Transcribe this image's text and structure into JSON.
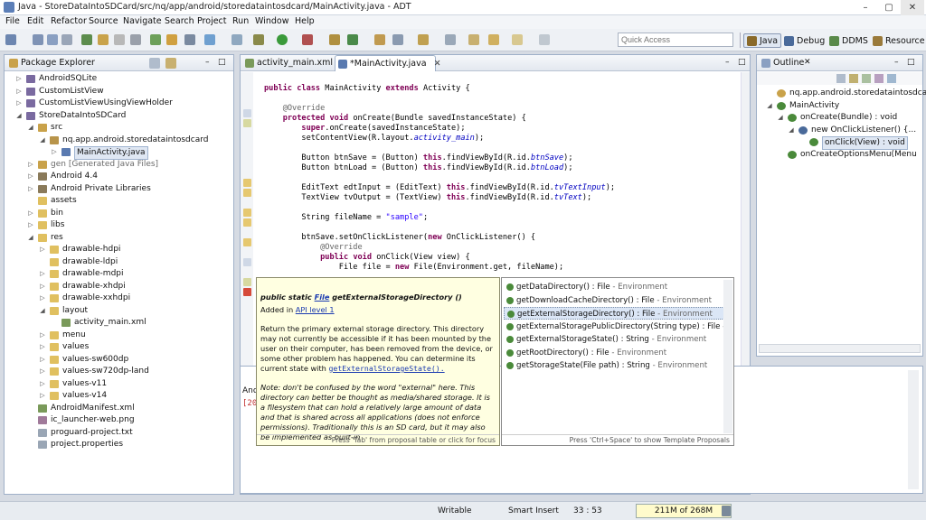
{
  "window": {
    "title": "Java - StoreDataIntoSDCard/src/nq/app/android/storedataintosdcard/MainActivity.java - ADT"
  },
  "menu": [
    "File",
    "Edit",
    "Refactor",
    "Source",
    "Navigate",
    "Search",
    "Project",
    "Run",
    "Window",
    "Help"
  ],
  "quick_access": {
    "placeholder": "Quick Access"
  },
  "perspectives": [
    {
      "label": "Java",
      "icon": "java-perspective-icon",
      "color": "#8a6a2a"
    },
    {
      "label": "Debug",
      "icon": "debug-perspective-icon",
      "color": "#4a6a9a"
    },
    {
      "label": "DDMS",
      "icon": "ddms-perspective-icon",
      "color": "#5a8a4a"
    },
    {
      "label": "Resource",
      "icon": "resource-perspective-icon",
      "color": "#9a7a3a"
    }
  ],
  "package_explorer": {
    "title": "Package Explorer",
    "items": [
      {
        "label": "AndroidSQLite",
        "depth": 0,
        "twisty": "▷",
        "icon": "project-icon"
      },
      {
        "label": "CustomListView",
        "depth": 0,
        "twisty": "▷",
        "icon": "project-icon"
      },
      {
        "label": "CustomListViewUsingViewHolder",
        "depth": 0,
        "twisty": "▷",
        "icon": "project-icon"
      },
      {
        "label": "StoreDataIntoSDCard",
        "depth": 0,
        "twisty": "◢",
        "icon": "project-icon"
      },
      {
        "label": "src",
        "depth": 1,
        "twisty": "◢",
        "icon": "source-folder-icon"
      },
      {
        "label": "nq.app.android.storedataintosdcard",
        "depth": 2,
        "twisty": "◢",
        "icon": "package-icon"
      },
      {
        "label": "MainActivity.java",
        "depth": 3,
        "twisty": "▷",
        "icon": "java-file-icon",
        "selected": true
      },
      {
        "label": "gen [Generated Java Files]",
        "depth": 1,
        "twisty": "▷",
        "icon": "source-folder-icon",
        "muted": true
      },
      {
        "label": "Android 4.4",
        "depth": 1,
        "twisty": "▷",
        "icon": "library-icon"
      },
      {
        "label": "Android Private Libraries",
        "depth": 1,
        "twisty": "▷",
        "icon": "library-icon"
      },
      {
        "label": "assets",
        "depth": 1,
        "twisty": "",
        "icon": "folder-icon"
      },
      {
        "label": "bin",
        "depth": 1,
        "twisty": "▷",
        "icon": "folder-icon"
      },
      {
        "label": "libs",
        "depth": 1,
        "twisty": "▷",
        "icon": "folder-icon"
      },
      {
        "label": "res",
        "depth": 1,
        "twisty": "◢",
        "icon": "folder-icon"
      },
      {
        "label": "drawable-hdpi",
        "depth": 2,
        "twisty": "▷",
        "icon": "folder-icon"
      },
      {
        "label": "drawable-ldpi",
        "depth": 2,
        "twisty": "",
        "icon": "folder-icon"
      },
      {
        "label": "drawable-mdpi",
        "depth": 2,
        "twisty": "▷",
        "icon": "folder-icon"
      },
      {
        "label": "drawable-xhdpi",
        "depth": 2,
        "twisty": "▷",
        "icon": "folder-icon"
      },
      {
        "label": "drawable-xxhdpi",
        "depth": 2,
        "twisty": "▷",
        "icon": "folder-icon"
      },
      {
        "label": "layout",
        "depth": 2,
        "twisty": "◢",
        "icon": "folder-icon"
      },
      {
        "label": "activity_main.xml",
        "depth": 3,
        "twisty": "",
        "icon": "xml-file-icon"
      },
      {
        "label": "menu",
        "depth": 2,
        "twisty": "▷",
        "icon": "folder-icon"
      },
      {
        "label": "values",
        "depth": 2,
        "twisty": "▷",
        "icon": "folder-icon"
      },
      {
        "label": "values-sw600dp",
        "depth": 2,
        "twisty": "▷",
        "icon": "folder-icon"
      },
      {
        "label": "values-sw720dp-land",
        "depth": 2,
        "twisty": "▷",
        "icon": "folder-icon"
      },
      {
        "label": "values-v11",
        "depth": 2,
        "twisty": "▷",
        "icon": "folder-icon"
      },
      {
        "label": "values-v14",
        "depth": 2,
        "twisty": "▷",
        "icon": "folder-icon"
      },
      {
        "label": "AndroidManifest.xml",
        "depth": 1,
        "twisty": "",
        "icon": "xml-file-icon"
      },
      {
        "label": "ic_launcher-web.png",
        "depth": 1,
        "twisty": "",
        "icon": "image-file-icon"
      },
      {
        "label": "proguard-project.txt",
        "depth": 1,
        "twisty": "",
        "icon": "text-file-icon"
      },
      {
        "label": "project.properties",
        "depth": 1,
        "twisty": "",
        "icon": "text-file-icon"
      }
    ]
  },
  "editor": {
    "tabs": [
      {
        "label": "activity_main.xml",
        "active": false
      },
      {
        "label": "*MainActivity.java",
        "active": true
      }
    ],
    "lines": [
      "public class MainActivity extends Activity {",
      "",
      "    @Override",
      "    protected void onCreate(Bundle savedInstanceState) {",
      "        super.onCreate(savedInstanceState);",
      "        setContentView(R.layout.activity_main);",
      "",
      "        Button btnSave = (Button) this.findViewById(R.id.btnSave);",
      "        Button btnLoad = (Button) this.findViewById(R.id.btnLoad);",
      "",
      "        EditText edtInput = (EditText) this.findViewById(R.id.tvTextInput);",
      "        TextView tvOutput = (TextView) this.findViewById(R.id.tvText);",
      "",
      "        String fileName = \"sample\";",
      "",
      "        btnSave.setOnClickListener(new OnClickListener() {",
      "            @Override",
      "            public void onClick(View view) {",
      "                File file = new File(Environment.get, fileName);"
    ]
  },
  "console": {
    "tab_label": "And",
    "line": "[20"
  },
  "outline": {
    "title": "Outline",
    "items": [
      {
        "label": "nq.app.android.storedataintosdca",
        "depth": 0,
        "twisty": ""
      },
      {
        "label": "MainActivity",
        "depth": 0,
        "twisty": "◢"
      },
      {
        "label": "onCreate(Bundle) : void",
        "depth": 1,
        "twisty": "◢"
      },
      {
        "label": "new OnClickListener() {...",
        "depth": 2,
        "twisty": "◢"
      },
      {
        "label": "onClick(View) : void",
        "depth": 3,
        "twisty": "",
        "selected": true
      },
      {
        "label": "onCreateOptionsMenu(Menu",
        "depth": 1,
        "twisty": ""
      }
    ]
  },
  "javadoc": {
    "signature_prefix": "public static ",
    "signature_type": "File",
    "signature_name": " getExternalStorageDirectory ()",
    "added_prefix": "Added in ",
    "added_link": "API level 1",
    "body1": "Return the primary external storage directory. This directory may not currently be accessible if it has been mounted by the user on their computer, has been removed from the device, or some other problem has happened. You can determine its current state with",
    "body1_link": "getExternalStorageState().",
    "body2": "Note: don't be confused by the word \"external\" here. This directory can better be thought as media/shared storage. It is a filesystem that can hold a relatively large amount of data and that is shared across all applications (does not enforce permissions). Traditionally this is an SD card, but it may also be implemented as built-in",
    "footer": "Press 'Tab' from proposal table or click for focus"
  },
  "proposals": {
    "items": [
      {
        "name": "getDataDirectory() : File",
        "owner": " - Environment",
        "selected": false
      },
      {
        "name": "getDownloadCacheDirectory() : File",
        "owner": " - Environment",
        "selected": false
      },
      {
        "name": "getExternalStorageDirectory() : File",
        "owner": " - Environment",
        "selected": true
      },
      {
        "name": "getExternalStoragePublicDirectory(String type) : File",
        "owner": " - Environ",
        "selected": false
      },
      {
        "name": "getExternalStorageState() : String",
        "owner": " - Environment",
        "selected": false
      },
      {
        "name": "getRootDirectory() : File",
        "owner": " - Environment",
        "selected": false
      },
      {
        "name": "getStorageState(File path) : String",
        "owner": " - Environment",
        "selected": false
      }
    ],
    "footer": "Press 'Ctrl+Space' to show Template Proposals"
  },
  "status": {
    "mode": "Writable",
    "insert": "Smart Insert",
    "position": "33 : 53",
    "heap": "211M of 268M"
  }
}
